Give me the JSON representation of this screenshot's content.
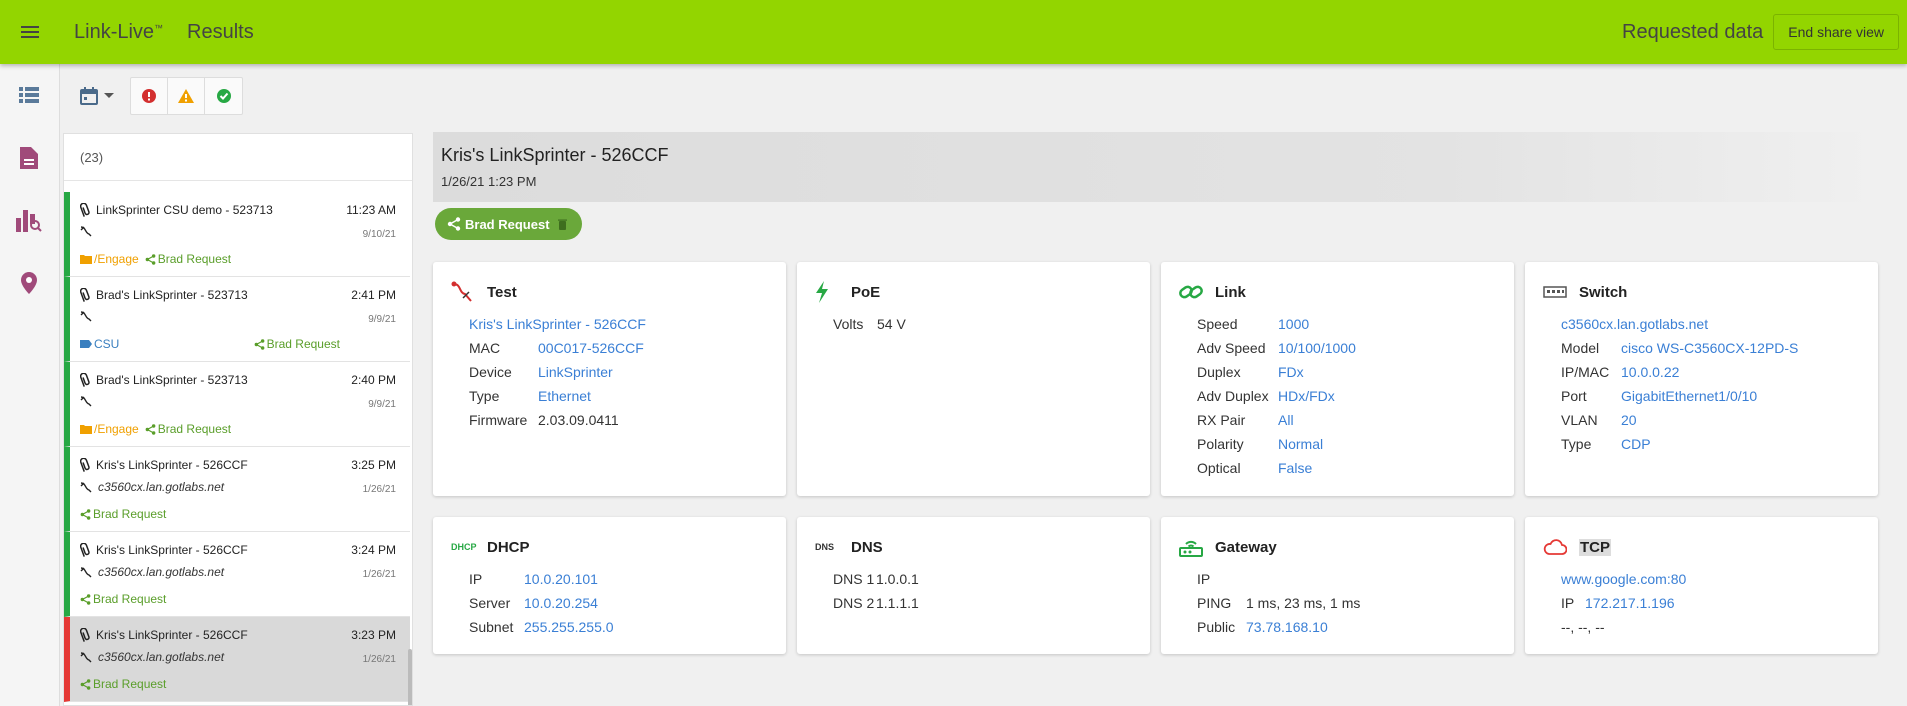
{
  "app": {
    "brand": "Link-Live",
    "brand_tm": "™",
    "page_title": "Results",
    "requested_label": "Requested data",
    "end_share_label": "End share view",
    "accent": "#93d500"
  },
  "toolbar": {
    "filters": [
      "error",
      "warning",
      "success"
    ]
  },
  "list": {
    "count": "(23)",
    "items": [
      {
        "title": "LinkSprinter CSU demo - 523713",
        "time": "11:23 AM",
        "sub": "",
        "date": "9/10/21",
        "folder": "/Engage",
        "label": "",
        "share": "Brad Request",
        "status": "pass"
      },
      {
        "title": "Brad's LinkSprinter - 523713",
        "time": "2:41 PM",
        "sub": "",
        "date": "9/9/21",
        "folder": "",
        "label": "CSU",
        "share": "Brad Request",
        "status": "pass"
      },
      {
        "title": "Brad's LinkSprinter - 523713",
        "time": "2:40 PM",
        "sub": "",
        "date": "9/9/21",
        "folder": "/Engage",
        "label": "",
        "share": "Brad Request",
        "status": "pass"
      },
      {
        "title": "Kris's LinkSprinter - 526CCF",
        "time": "3:25 PM",
        "sub": "c3560cx.lan.gotlabs.net",
        "date": "1/26/21",
        "folder": "",
        "label": "",
        "share": "Brad Request",
        "status": "pass"
      },
      {
        "title": "Kris's LinkSprinter - 526CCF",
        "time": "3:24 PM",
        "sub": "c3560cx.lan.gotlabs.net",
        "date": "1/26/21",
        "folder": "",
        "label": "",
        "share": "Brad Request",
        "status": "pass"
      },
      {
        "title": "Kris's LinkSprinter - 526CCF",
        "time": "3:23 PM",
        "sub": "c3560cx.lan.gotlabs.net",
        "date": "1/26/21",
        "folder": "",
        "label": "",
        "share": "Brad Request",
        "status": "fail"
      }
    ]
  },
  "detail": {
    "title": "Kris's LinkSprinter - 526CCF",
    "date": "1/26/21 1:23 PM",
    "share_chip": "Brad Request",
    "test": {
      "heading": "Test",
      "name": "Kris's LinkSprinter - 526CCF",
      "rows": [
        {
          "k": "MAC",
          "v": "00C017-526CCF"
        },
        {
          "k": "Device",
          "v": "LinkSprinter"
        },
        {
          "k": "Type",
          "v": "Ethernet"
        },
        {
          "k": "Firmware",
          "v": "2.03.09.0411"
        }
      ]
    },
    "poe": {
      "heading": "PoE",
      "rows": [
        {
          "k": "Volts",
          "v": "54 V"
        }
      ]
    },
    "link": {
      "heading": "Link",
      "rows": [
        {
          "k": "Speed",
          "v": "1000"
        },
        {
          "k": "Adv Speed",
          "v": "10/100/1000"
        },
        {
          "k": "Duplex",
          "v": "FDx"
        },
        {
          "k": "Adv Duplex",
          "v": "HDx/FDx"
        },
        {
          "k": "RX Pair",
          "v": "All"
        },
        {
          "k": "Polarity",
          "v": "Normal"
        },
        {
          "k": "Optical",
          "v": "False"
        }
      ]
    },
    "switch": {
      "heading": "Switch",
      "name": "c3560cx.lan.gotlabs.net",
      "rows": [
        {
          "k": "Model",
          "v": "cisco WS-C3560CX-12PD-S"
        },
        {
          "k": "IP/MAC",
          "v": "10.0.0.22"
        },
        {
          "k": "Port",
          "v": "GigabitEthernet1/0/10"
        },
        {
          "k": "VLAN",
          "v": "20"
        },
        {
          "k": "Type",
          "v": "CDP"
        }
      ]
    },
    "dhcp": {
      "heading": "DHCP",
      "icon_text": "DHCP",
      "rows": [
        {
          "k": "IP",
          "v": "10.0.20.101"
        },
        {
          "k": "Server",
          "v": "10.0.20.254"
        },
        {
          "k": "Subnet",
          "v": "255.255.255.0"
        }
      ]
    },
    "dns": {
      "heading": "DNS",
      "icon_text": "DNS",
      "rows": [
        {
          "k": "DNS 1",
          "v": "1.0.0.1"
        },
        {
          "k": "DNS 2",
          "v": "1.1.1.1"
        }
      ]
    },
    "gateway": {
      "heading": "Gateway",
      "rows": [
        {
          "k": "IP",
          "v": ""
        },
        {
          "k": "PING",
          "v": "1 ms, 23 ms, 1 ms"
        },
        {
          "k": "Public",
          "v": "73.78.168.10"
        }
      ]
    },
    "tcp": {
      "heading": "TCP",
      "target": "www.google.com:80",
      "ip_label": "IP",
      "ip": "172.217.1.196",
      "extra": "--, --, --"
    }
  }
}
